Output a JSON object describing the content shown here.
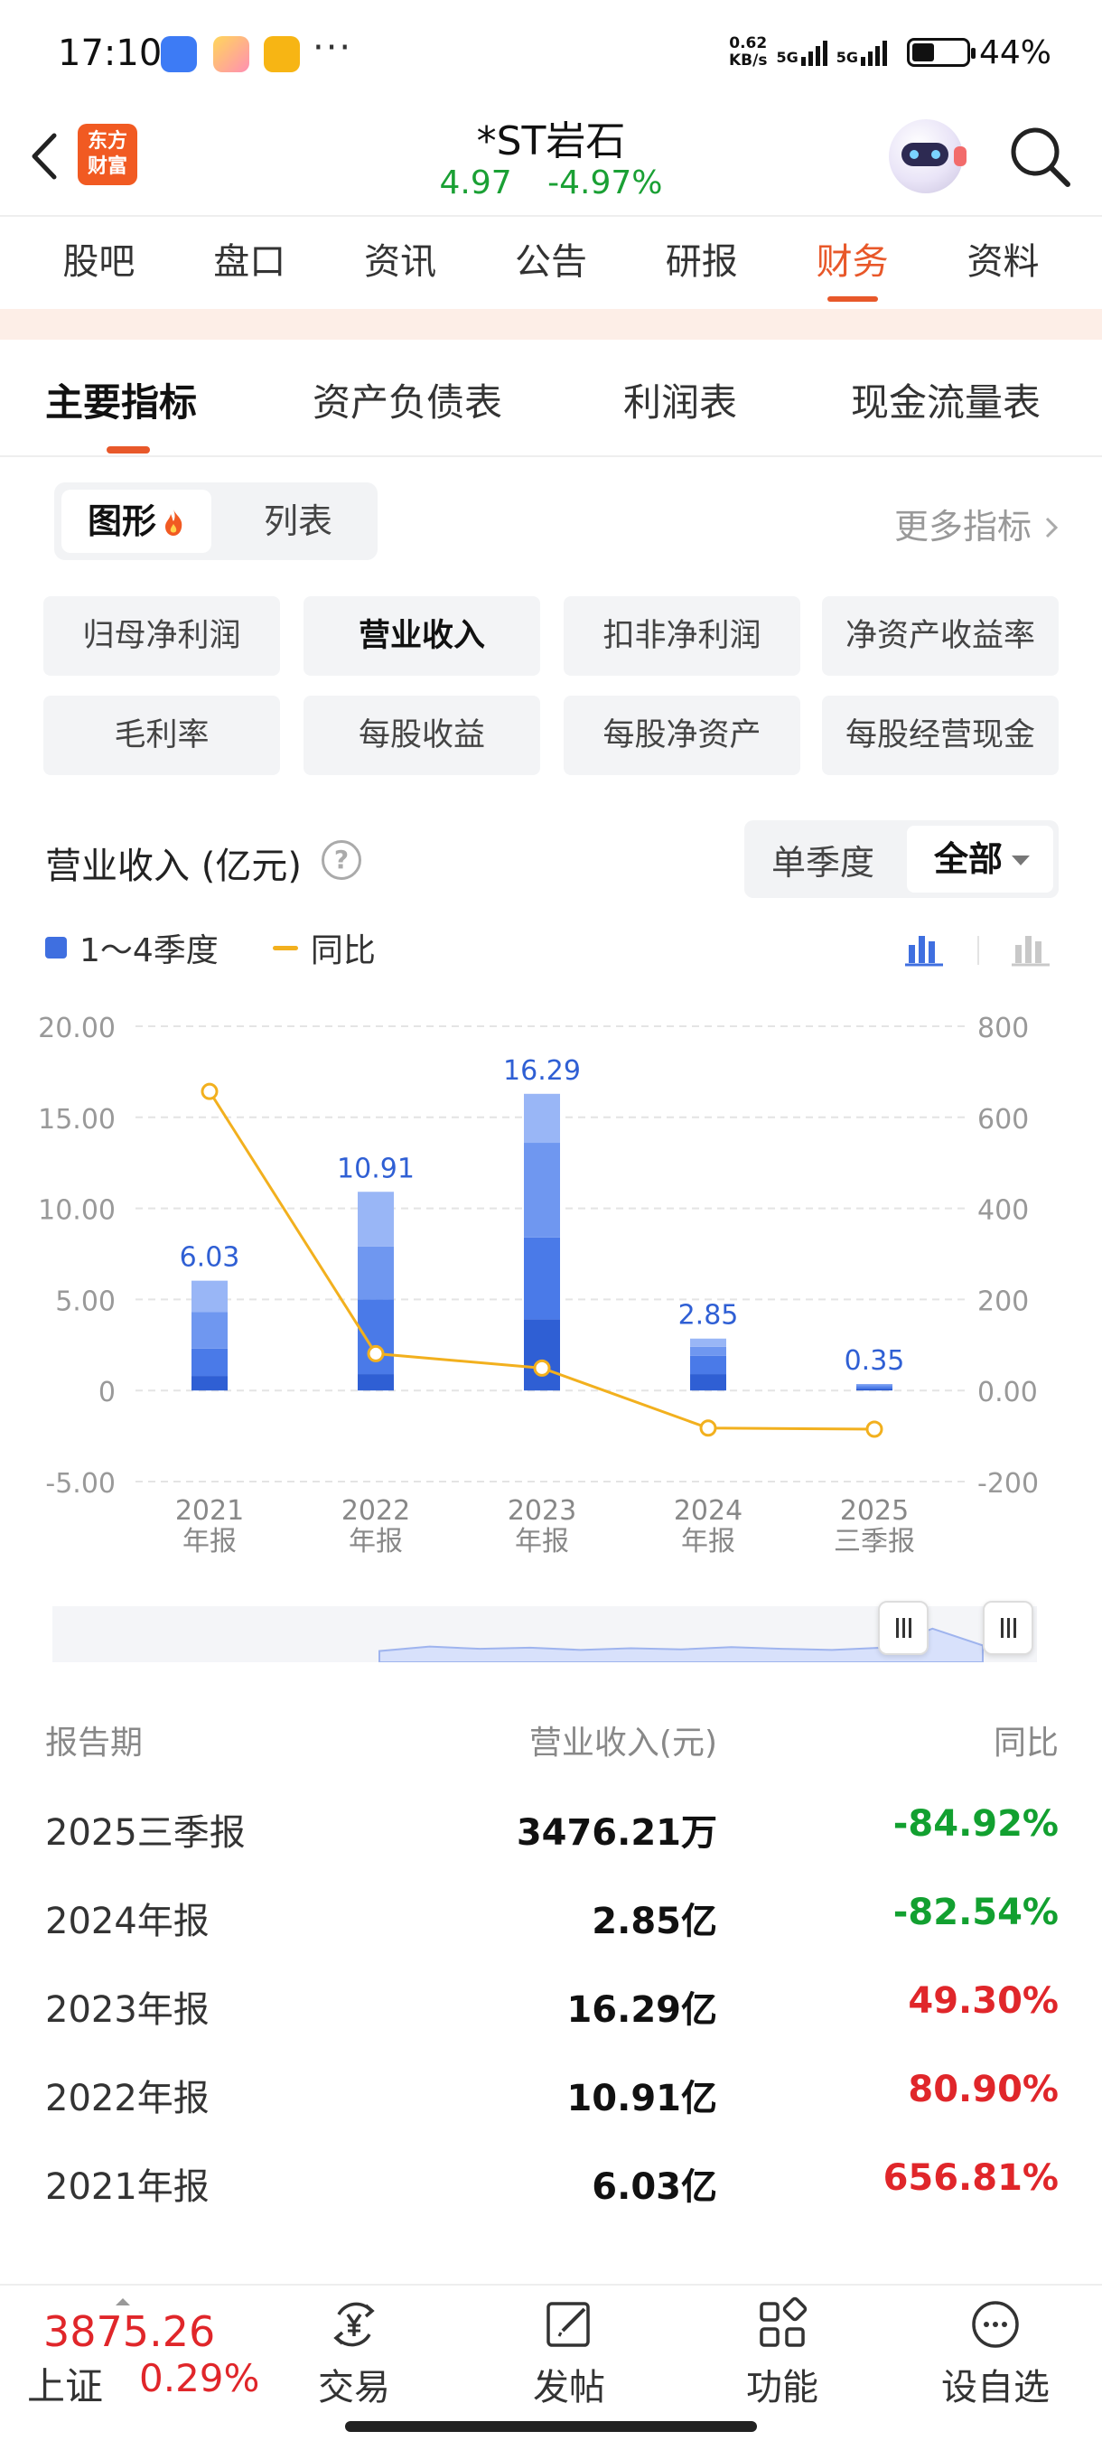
{
  "status_bar": {
    "time": "17:10",
    "more": "···",
    "net_speed_value": "0.62",
    "net_speed_unit": "KB/s",
    "signal1_label": "5G",
    "signal2_label": "5G",
    "battery": "44%",
    "app_icons": [
      "app-icon-blue",
      "app-icon-yellow-hand",
      "app-icon-yellow-note"
    ]
  },
  "header": {
    "back_icon": "back-arrow-icon",
    "logo_line1": "东方",
    "logo_line2": "财富",
    "stock_name": "*ST岩石",
    "price": "4.97",
    "change": "-4.97%",
    "avatar": "robot-avatar",
    "search_icon": "search-icon"
  },
  "main_tabs": [
    {
      "label": "股吧"
    },
    {
      "label": "盘口"
    },
    {
      "label": "资讯"
    },
    {
      "label": "公告"
    },
    {
      "label": "研报"
    },
    {
      "label": "财务",
      "active": true
    },
    {
      "label": "资料"
    }
  ],
  "sub_tabs": [
    {
      "label": "主要指标",
      "active": true
    },
    {
      "label": "资产负债表"
    },
    {
      "label": "利润表"
    },
    {
      "label": "现金流量表"
    }
  ],
  "view_toggle": {
    "graph": "图形",
    "list": "列表"
  },
  "more_metrics": "更多指标",
  "metric_chips": [
    {
      "label": "归母净利润"
    },
    {
      "label": "营业收入",
      "active": true
    },
    {
      "label": "扣非净利润"
    },
    {
      "label": "净资产收益率"
    },
    {
      "label": "毛利率"
    },
    {
      "label": "每股收益"
    },
    {
      "label": "每股净资产"
    },
    {
      "label": "每股经营现金"
    }
  ],
  "chart_header": {
    "title": "营业收入 (亿元)",
    "help": "?",
    "period_single": "单季度",
    "period_all": "全部"
  },
  "legend": {
    "bars": "1～4季度",
    "line": "同比"
  },
  "colors": {
    "accent": "#e8582a",
    "bar_q1": "#2f5fd4",
    "bar_q2": "#4a7ae8",
    "bar_q3": "#6f97f0",
    "bar_q4": "#99b6f6",
    "line": "#f2b01e",
    "up": "#e0262a",
    "down": "#12a030"
  },
  "chart_data": {
    "type": "bar",
    "title": "营业收入 (亿元)",
    "categories": [
      {
        "year": "2021",
        "label": "年报"
      },
      {
        "year": "2022",
        "label": "年报"
      },
      {
        "year": "2023",
        "label": "年报"
      },
      {
        "year": "2024",
        "label": "年报"
      },
      {
        "year": "2025",
        "label": "三季报"
      }
    ],
    "totals": [
      6.03,
      10.91,
      16.29,
      2.85,
      0.35
    ],
    "total_labels": [
      "6.03",
      "10.91",
      "16.29",
      "2.85",
      "0.35"
    ],
    "series": [
      {
        "name": "1～4季度",
        "stack_values": [
          [
            0.8,
            1.5,
            2.0,
            1.73
          ],
          [
            0.9,
            4.1,
            2.9,
            3.01
          ],
          [
            3.9,
            4.5,
            5.2,
            2.69
          ],
          [
            0.9,
            1.0,
            0.5,
            0.45
          ],
          [
            0.12,
            0.12,
            0.11
          ]
        ]
      },
      {
        "name": "同比",
        "values": [
          656.81,
          80.9,
          49.3,
          -82.54,
          -84.92
        ]
      }
    ],
    "y_left": {
      "min": -5,
      "max": 20,
      "ticks": [
        "20.00",
        "15.00",
        "10.00",
        "5.00",
        "0",
        "-5.00"
      ],
      "tick_values": [
        20,
        15,
        10,
        5,
        0,
        -5
      ]
    },
    "y_right": {
      "min": -200,
      "max": 800,
      "ticks": [
        "800",
        "600",
        "400",
        "200",
        "0.00",
        "-200"
      ],
      "tick_values": [
        800,
        600,
        400,
        200,
        0,
        -200
      ]
    },
    "grid": true,
    "legend_position": "top-left"
  },
  "range_slider": {
    "sparkline": [
      0.2,
      0.28,
      0.24,
      0.26,
      0.22,
      0.25,
      0.23,
      0.27,
      0.24,
      0.22,
      0.26,
      0.6,
      0.3
    ]
  },
  "table": {
    "headers": [
      "报告期",
      "营业收入(元)",
      "同比"
    ],
    "rows": [
      {
        "period": "2025三季报",
        "revenue": "3476.21万",
        "yoy": "-84.92%",
        "dir": "neg"
      },
      {
        "period": "2024年报",
        "revenue": "2.85亿",
        "yoy": "-82.54%",
        "dir": "neg"
      },
      {
        "period": "2023年报",
        "revenue": "16.29亿",
        "yoy": "49.30%",
        "dir": "pos"
      },
      {
        "period": "2022年报",
        "revenue": "10.91亿",
        "yoy": "80.90%",
        "dir": "pos"
      },
      {
        "period": "2021年报",
        "revenue": "6.03亿",
        "yoy": "656.81%",
        "dir": "pos"
      }
    ]
  },
  "bottom_bar": {
    "index_value": "3875.26",
    "index_name": "上证",
    "index_change": "0.29%",
    "nav": [
      {
        "label": "交易",
        "icon": "yen-exchange-icon"
      },
      {
        "label": "发帖",
        "icon": "edit-post-icon"
      },
      {
        "label": "功能",
        "icon": "grid-apps-icon"
      },
      {
        "label": "设自选",
        "icon": "more-dots-icon"
      }
    ]
  }
}
